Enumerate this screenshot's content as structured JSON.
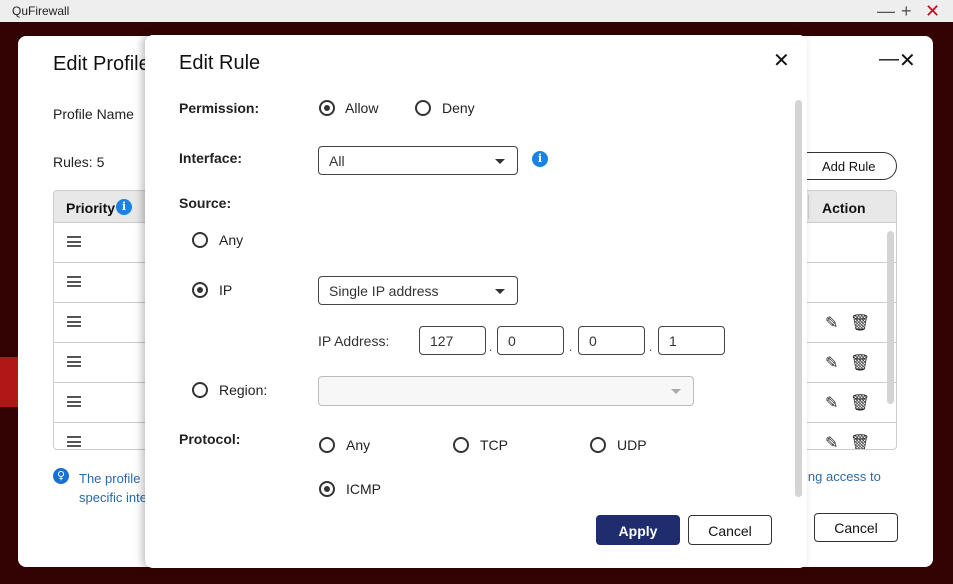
{
  "app": {
    "title": "QuFirewall",
    "minimize": "—",
    "maximize": "+",
    "close": "✕",
    "close_color": "#d0021b"
  },
  "profile_dialog": {
    "title": "Edit Profile",
    "minimize": "—",
    "close": "✕",
    "profile_name_label": "Profile Name",
    "rules_count": "Rules: 5",
    "add_rule": "Add Rule",
    "table": {
      "headers": {
        "priority": "Priority",
        "action": "Action"
      },
      "row_count": 6
    },
    "note_left_1": "The profile",
    "note_left_2": "specific inte",
    "note_right": "ing access to",
    "cancel": "Cancel"
  },
  "rule_dialog": {
    "title": "Edit Rule",
    "close": "✕",
    "permission": {
      "label": "Permission:",
      "options": [
        "Allow",
        "Deny"
      ],
      "selected": "Allow"
    },
    "interface": {
      "label": "Interface:",
      "value": "All"
    },
    "source": {
      "label": "Source:",
      "any": "Any",
      "ip": "IP",
      "region": "Region:",
      "selected": "IP",
      "ip_type": "Single IP address",
      "ip_address_label": "IP Address:",
      "octets": [
        "127",
        "0",
        "0",
        "1"
      ],
      "region_value": ""
    },
    "protocol": {
      "label": "Protocol:",
      "options": [
        "Any",
        "TCP",
        "UDP",
        "ICMP"
      ],
      "selected": "ICMP"
    },
    "apply": "Apply",
    "cancel": "Cancel",
    "accent": "#1f2d6e"
  }
}
